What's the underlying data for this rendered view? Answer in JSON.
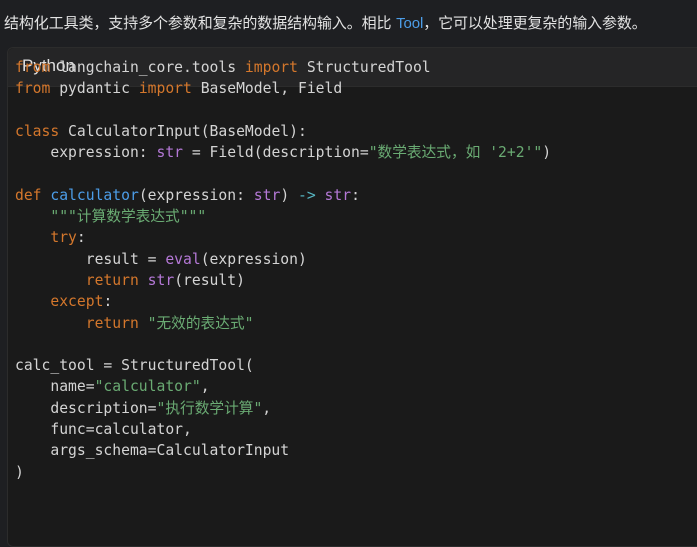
{
  "intro": {
    "before": "结构化工具类，支持多个参数和复杂的数据结构输入。相比 ",
    "link": "Tool",
    "after": "，它可以处理更复杂的输入参数。"
  },
  "code_block": {
    "language": "Python",
    "lines": [
      [
        [
          "kw",
          "from"
        ],
        [
          "plain",
          " langchain_core.tools "
        ],
        [
          "kw",
          "import"
        ],
        [
          "plain",
          " StructuredTool"
        ]
      ],
      [
        [
          "kw",
          "from"
        ],
        [
          "plain",
          " pydantic "
        ],
        [
          "kw",
          "import"
        ],
        [
          "plain",
          " BaseModel, Field"
        ]
      ],
      [],
      [
        [
          "kw",
          "class"
        ],
        [
          "plain",
          " CalculatorInput(BaseModel):"
        ]
      ],
      [
        [
          "plain",
          "    expression: "
        ],
        [
          "builtin",
          "str"
        ],
        [
          "plain",
          " = Field(description="
        ],
        [
          "str",
          "\"数学表达式，如 '2+2'\""
        ],
        [
          "plain",
          ")"
        ]
      ],
      [],
      [
        [
          "kw",
          "def"
        ],
        [
          "plain",
          " "
        ],
        [
          "fn",
          "calculator"
        ],
        [
          "plain",
          "(expression: "
        ],
        [
          "builtin",
          "str"
        ],
        [
          "plain",
          ") "
        ],
        [
          "op",
          "->"
        ],
        [
          "plain",
          " "
        ],
        [
          "builtin",
          "str"
        ],
        [
          "plain",
          ":"
        ]
      ],
      [
        [
          "str",
          "    \"\"\"计算数学表达式\"\"\""
        ]
      ],
      [
        [
          "plain",
          "    "
        ],
        [
          "kw",
          "try"
        ],
        [
          "plain",
          ":"
        ]
      ],
      [
        [
          "plain",
          "        result = "
        ],
        [
          "builtin",
          "eval"
        ],
        [
          "plain",
          "(expression)"
        ]
      ],
      [
        [
          "plain",
          "        "
        ],
        [
          "kw",
          "return"
        ],
        [
          "plain",
          " "
        ],
        [
          "builtin",
          "str"
        ],
        [
          "plain",
          "(result)"
        ]
      ],
      [
        [
          "plain",
          "    "
        ],
        [
          "kw",
          "except"
        ],
        [
          "plain",
          ":"
        ]
      ],
      [
        [
          "plain",
          "        "
        ],
        [
          "kw",
          "return"
        ],
        [
          "plain",
          " "
        ],
        [
          "str",
          "\"无效的表达式\""
        ]
      ],
      [],
      [
        [
          "plain",
          "calc_tool = StructuredTool("
        ]
      ],
      [
        [
          "plain",
          "    name="
        ],
        [
          "str",
          "\"calculator\""
        ],
        [
          "plain",
          ","
        ]
      ],
      [
        [
          "plain",
          "    description="
        ],
        [
          "str",
          "\"执行数学计算\""
        ],
        [
          "plain",
          ","
        ]
      ],
      [
        [
          "plain",
          "    func=calculator,"
        ]
      ],
      [
        [
          "plain",
          "    args_schema=CalculatorInput"
        ]
      ],
      [
        [
          "plain",
          ")"
        ]
      ]
    ]
  }
}
